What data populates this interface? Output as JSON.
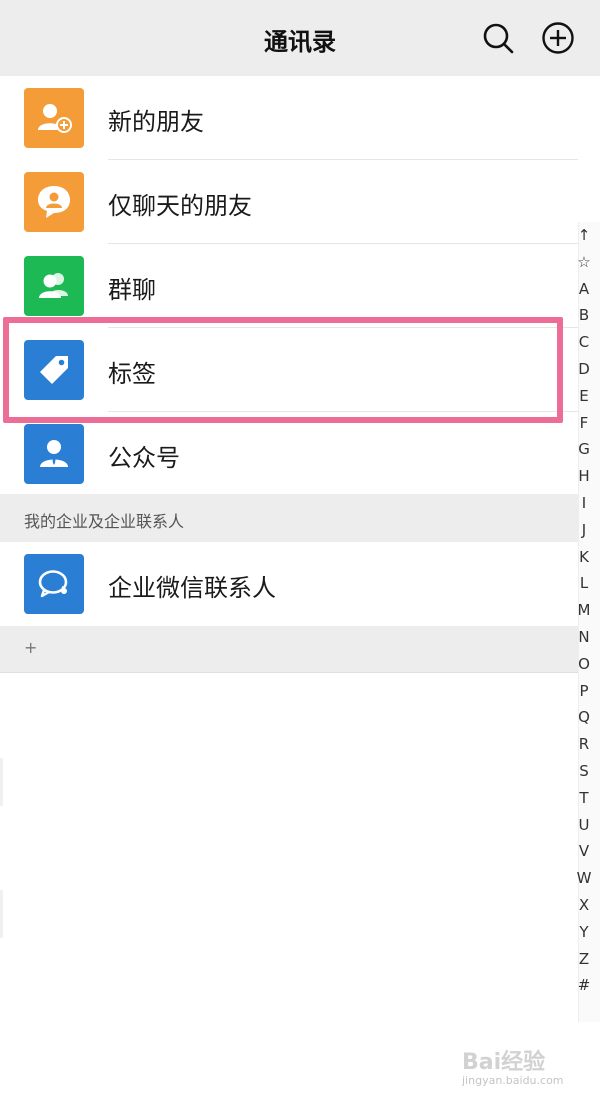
{
  "header": {
    "title": "通讯录",
    "search_icon": "search-icon",
    "add_icon": "add-circle-icon"
  },
  "rows": [
    {
      "label": "新的朋友",
      "icon": "add-friend-icon",
      "color": "#f39c38"
    },
    {
      "label": "仅聊天的朋友",
      "icon": "chat-only-friend-icon",
      "color": "#f39c38"
    },
    {
      "label": "群聊",
      "icon": "group-chat-icon",
      "color": "#1db954"
    },
    {
      "label": "标签",
      "icon": "tag-icon",
      "color": "#2a7fd4"
    },
    {
      "label": "公众号",
      "icon": "official-account-icon",
      "color": "#2a7fd4"
    }
  ],
  "section": {
    "title": "我的企业及企业联系人"
  },
  "enterprise_row": {
    "label": "企业微信联系人",
    "icon": "wecom-contact-icon",
    "color": "#2a7fd4"
  },
  "footer": {
    "plus": "+"
  },
  "index": [
    "↑",
    "☆",
    "A",
    "B",
    "C",
    "D",
    "E",
    "F",
    "G",
    "H",
    "I",
    "J",
    "K",
    "L",
    "M",
    "N",
    "O",
    "P",
    "Q",
    "R",
    "S",
    "T",
    "U",
    "V",
    "W",
    "X",
    "Y",
    "Z",
    "#"
  ],
  "highlight_color": "#ec6d95",
  "watermark": {
    "brand": "Bai经验",
    "url": "jingyan.baidu.com"
  }
}
